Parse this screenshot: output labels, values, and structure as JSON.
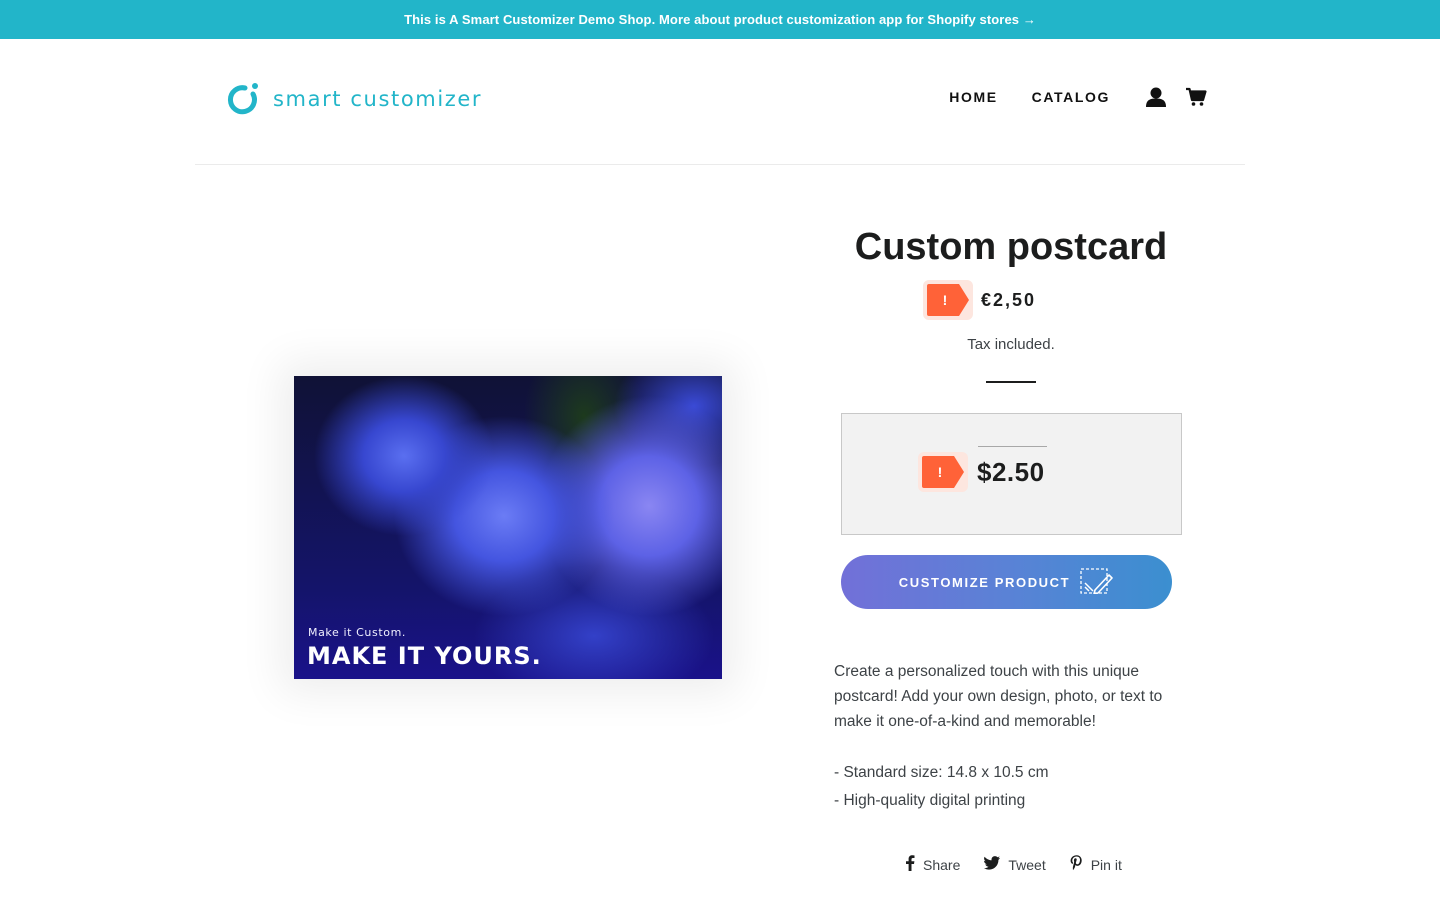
{
  "announcement": {
    "text": "This is A Smart Customizer Demo Shop. More about product customization app for Shopify stores →"
  },
  "header": {
    "logo_text": "smart customizer",
    "logo_icon": "smart-customizer-ring-icon",
    "nav": [
      {
        "label": "HOME"
      },
      {
        "label": "CATALOG"
      }
    ],
    "icons": [
      "account-icon",
      "cart-icon"
    ]
  },
  "product": {
    "title": "Custom postcard",
    "price": "€2,50",
    "tax_note": "Tax included.",
    "image": {
      "overlay_small": "Make it Custom.",
      "overlay_big": "MAKE IT YOURS."
    },
    "warning_badge": "!",
    "app_price": "$2.50",
    "customize_label": "CUSTOMIZE PRODUCT",
    "customize_icon": "customize-edit-icon",
    "description": "Create a personalized touch with this unique postcard! Add your own design, photo, or text to make it one-of-a-kind and memorable!",
    "features": [
      "- Standard size: 14.8 x 10.5 cm",
      "- High-quality digital printing"
    ]
  },
  "share": [
    {
      "label": "Share",
      "icon": "facebook-icon"
    },
    {
      "label": "Tweet",
      "icon": "twitter-icon"
    },
    {
      "label": "Pin it",
      "icon": "pinterest-icon"
    }
  ],
  "colors": {
    "accent": "#22b5c9",
    "warning": "#ff6238",
    "button_gradient_start": "#7270d8",
    "button_gradient_end": "#3b8fd0"
  }
}
